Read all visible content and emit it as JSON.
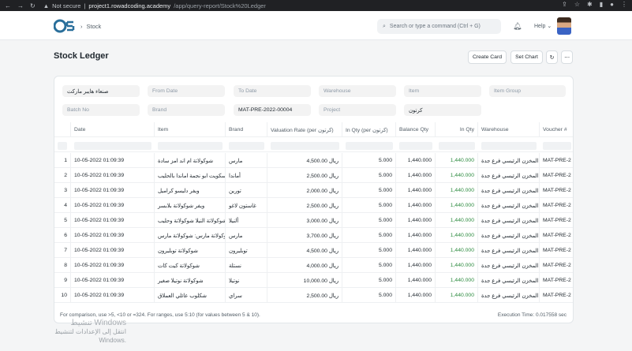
{
  "browser": {
    "security": "Not secure",
    "host": "project1.rowadcoding.academy",
    "path": "/app/query-report/Stock%20Ledger"
  },
  "navbar": {
    "breadcrumb": "Stock",
    "search_placeholder": "Search or type a command (Ctrl + G)",
    "help_label": "Help"
  },
  "page": {
    "title": "Stock Ledger",
    "create_card": "Create Card",
    "set_chart": "Set Chart"
  },
  "filters": {
    "company": "صنعاء هايبر ماركت",
    "from_date": "From Date",
    "to_date": "To Date",
    "warehouse": "Warehouse",
    "item": "Item",
    "item_group": "Item Group",
    "batch_no": "Batch No",
    "brand": "Brand",
    "voucher_no": "MAT-PRE-2022-00004",
    "project": "Project",
    "uom": "كرتون"
  },
  "table": {
    "columns": [
      "Date",
      "Item",
      "Brand",
      "Valuation Rate (per كرتون)",
      "In Qty (per كرتون)",
      "Balance Qty",
      "In Qty",
      "Warehouse",
      "Voucher #"
    ],
    "rows": [
      {
        "n": "1",
        "date": "10-05-2022 01:09:39",
        "item": "شوكولاتة ام اند امز سادة",
        "brand": "مارس",
        "rate": "4,500.00 ريال",
        "inq": "5.000",
        "bal": "1,440.000",
        "in": "1,440.000",
        "wh": "المخزن الرئيسي فرع جدة",
        "vch": "MAT-PRE-2"
      },
      {
        "n": "2",
        "date": "10-05-2022 01:09:39",
        "item": "بسكويت ابو نجمة اماندا بالحليب",
        "brand": "أماندا",
        "rate": "2,500.00 ريال",
        "inq": "5.000",
        "bal": "1,440.000",
        "in": "1,440.000",
        "wh": "المخزن الرئيسي فرع جدة",
        "vch": "MAT-PRE-2"
      },
      {
        "n": "3",
        "date": "10-05-2022 01:09:39",
        "item": "ويفر دليسو كراميل",
        "brand": "تورين",
        "rate": "2,000.00 ريال",
        "inq": "5.000",
        "bal": "1,440.000",
        "in": "1,440.000",
        "wh": "المخزن الرئيسي فرع جدة",
        "vch": "MAT-PRE-2"
      },
      {
        "n": "4",
        "date": "10-05-2022 01:09:39",
        "item": "ويفر شوكولاتة بلابسر",
        "brand": "غاستون لاغو",
        "rate": "2,500.00 ريال",
        "inq": "5.000",
        "bal": "1,440.000",
        "in": "1,440.000",
        "wh": "المخزن الرئيسي فرع جدة",
        "vch": "MAT-PRE-2"
      },
      {
        "n": "5",
        "date": "10-05-2022 01:09:39",
        "item": "شوكولاتة النيلا شوكولاتة وحليب",
        "brand": "ألنيلا",
        "rate": "3,000.00 ريال",
        "inq": "5.000",
        "bal": "1,440.000",
        "in": "1,440.000",
        "wh": "المخزن الرئيسي فرع جدة",
        "vch": "MAT-PRE-2"
      },
      {
        "n": "6",
        "date": "10-05-2022 01:09:39",
        "item": "شوكولاتة مارس: شوكولاتة مارس",
        "brand": "مارس",
        "rate": "3,700.00 ريال",
        "inq": "5.000",
        "bal": "1,440.000",
        "in": "1,440.000",
        "wh": "المخزن الرئيسي فرع جدة",
        "vch": "MAT-PRE-2"
      },
      {
        "n": "7",
        "date": "10-05-2022 01:09:39",
        "item": "شوكولاتة توبليرون",
        "brand": "توبليرون",
        "rate": "4,500.00 ريال",
        "inq": "5.000",
        "bal": "1,440.000",
        "in": "1,440.000",
        "wh": "المخزن الرئيسي فرع جدة",
        "vch": "MAT-PRE-2"
      },
      {
        "n": "8",
        "date": "10-05-2022 01:09:39",
        "item": "شوكولاتة كيت كات",
        "brand": "نستلة",
        "rate": "4,000.00 ريال",
        "inq": "5.000",
        "bal": "1,440.000",
        "in": "1,440.000",
        "wh": "المخزن الرئيسي فرع جدة",
        "vch": "MAT-PRE-2"
      },
      {
        "n": "9",
        "date": "10-05-2022 01:09:39",
        "item": "شوكولاتة نوتيلا صغير",
        "brand": "نوتيلا",
        "rate": "10,000.00 ريال",
        "inq": "5.000",
        "bal": "1,440.000",
        "in": "1,440.000",
        "wh": "المخزن الرئيسي فرع جدة",
        "vch": "MAT-PRE-2"
      },
      {
        "n": "10",
        "date": "10-05-2022 01:09:39",
        "item": "شكلوب عائلي العملاق",
        "brand": "سراي",
        "rate": "2,500.00 ريال",
        "inq": "5.000",
        "bal": "1,440.000",
        "in": "1,440.000",
        "wh": "المخزن الرئيسي فرع جدة",
        "vch": "MAT-PRE-2"
      }
    ]
  },
  "footer": {
    "note": "For comparison, use >5, <10 or =324. For ranges, use 5:10 (for values between 5 & 10).",
    "exec": "Execution Time: 0.017558 sec"
  },
  "watermark": {
    "line1": "تنشيط Windows",
    "line2": "انتقل إلى الإعدادات لتنشيط Windows."
  },
  "colors": {
    "accent_green": "#2b8a3e",
    "chrome_bg": "#202124"
  }
}
